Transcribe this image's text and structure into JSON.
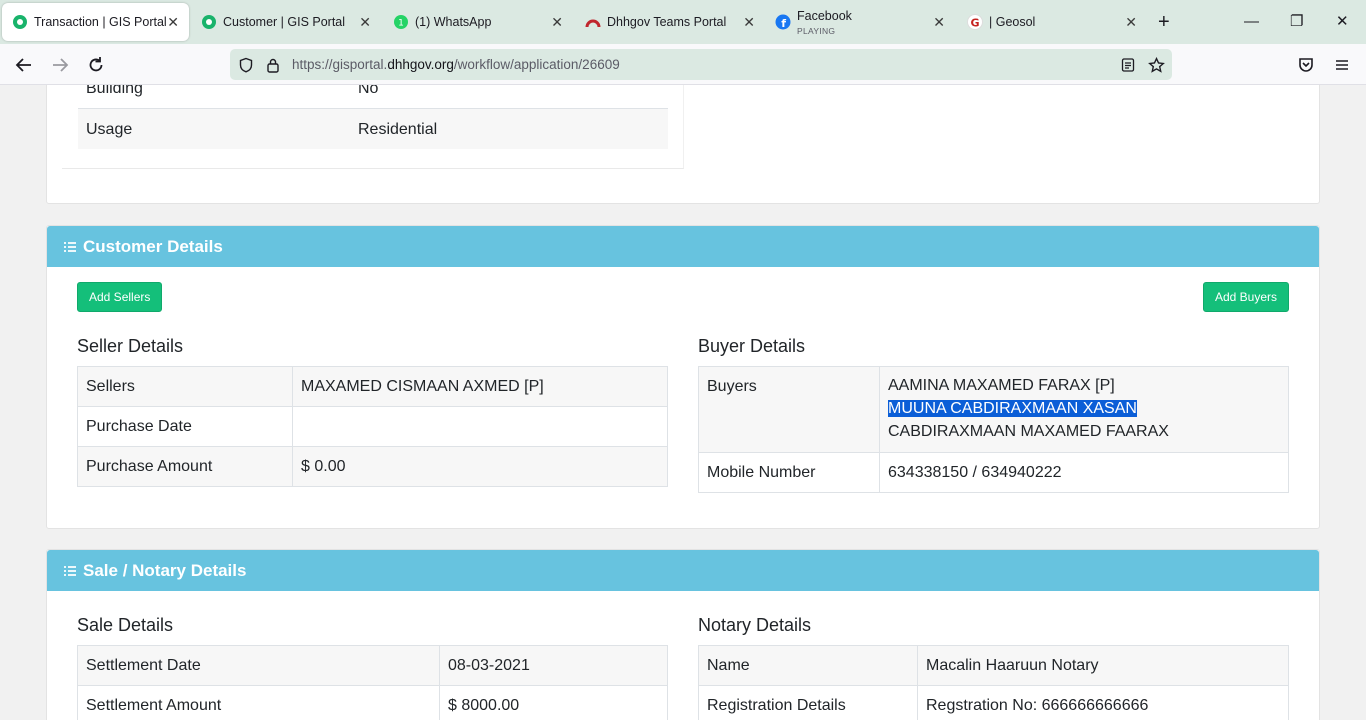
{
  "browser": {
    "tabs": [
      {
        "label": "Transaction | GIS Portal",
        "active": true
      },
      {
        "label": "Customer | GIS Portal"
      },
      {
        "label": "(1) WhatsApp"
      },
      {
        "label": "Dhhgov Teams Portal"
      },
      {
        "label": "Facebook",
        "sub": "PLAYING"
      },
      {
        "label": "| Geosol"
      }
    ],
    "url_prefix": "https://gisportal.",
    "url_domain": "dhhgov.org",
    "url_path": "/workflow/application/26609"
  },
  "property": {
    "rows": [
      {
        "label": "Building",
        "value": "No"
      },
      {
        "label": "Usage",
        "value": "Residential"
      }
    ]
  },
  "customer": {
    "title": "Customer Details",
    "add_sellers": "Add Sellers",
    "add_buyers": "Add Buyers",
    "seller_title": "Seller Details",
    "buyer_title": "Buyer Details",
    "seller_rows": [
      {
        "label": "Sellers",
        "value": "MAXAMED CISMAAN AXMED [P]"
      },
      {
        "label": "Purchase Date",
        "value": ""
      },
      {
        "label": "Purchase Amount",
        "value": "$ 0.00"
      }
    ],
    "buyers_label": "Buyers",
    "buyers": [
      "AAMINA MAXAMED FARAX [P]",
      "MUUNA CABDIRAXMAAN XASAN",
      "CABDIRAXMAAN MAXAMED FAARAX"
    ],
    "mobile_label": "Mobile Number",
    "mobile_value": "634338150 / 634940222"
  },
  "sale": {
    "title": "Sale / Notary Details",
    "sale_title": "Sale Details",
    "notary_title": "Notary Details",
    "sale_rows": [
      {
        "label": "Settlement Date",
        "value": "08-03-2021"
      },
      {
        "label": "Settlement Amount",
        "value": "$ 8000.00"
      }
    ],
    "notary_rows": [
      {
        "label": "Name",
        "value": "Macalin Haaruun Notary"
      },
      {
        "label": "Registration Details",
        "value": "Regstration No: 666666666666"
      }
    ]
  },
  "colors": {
    "header": "#67c3df",
    "button": "#14bf7a",
    "selection": "#0b5ed7"
  }
}
